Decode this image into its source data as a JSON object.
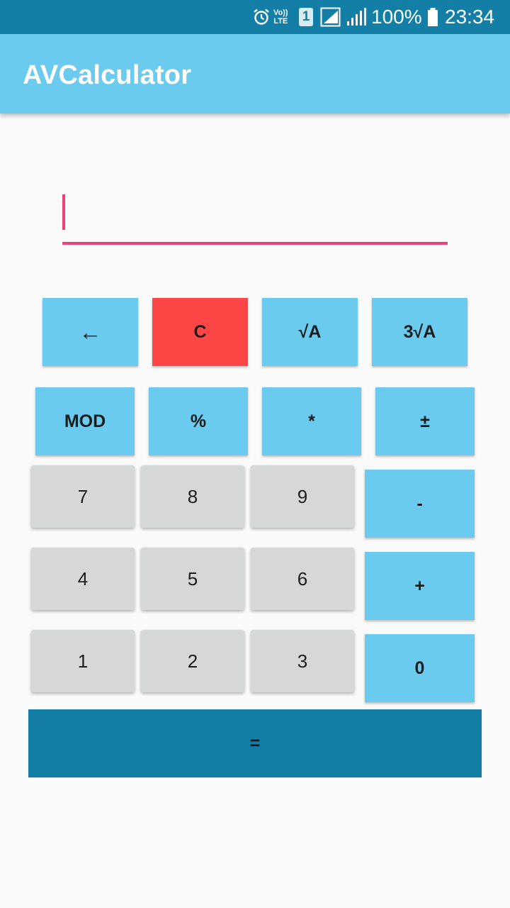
{
  "status_bar": {
    "volte_line1": "Vo))",
    "volte_line2": "LTE",
    "sim_slot": "1",
    "battery_text": "100%",
    "time": "23:34",
    "icons": [
      "alarm-icon",
      "signal-icon",
      "battery-icon"
    ]
  },
  "app": {
    "title": "AVCalculator"
  },
  "display": {
    "value": ""
  },
  "keypad": {
    "backspace": "←",
    "clear": "C",
    "sqrt": "√A",
    "cbrt": "3√A",
    "mod": "MOD",
    "percent": "%",
    "multiply": "*",
    "plus_minus": "±",
    "seven": "7",
    "eight": "8",
    "nine": "9",
    "minus": "-",
    "four": "4",
    "five": "5",
    "six": "6",
    "plus": "+",
    "one": "1",
    "two": "2",
    "three": "3",
    "zero": "0",
    "equals": "="
  },
  "colors": {
    "status_bar": "#137fa6",
    "app_bar": "#6acbee",
    "accent": "#ec407a",
    "operator_button": "#6acbee",
    "clear_button": "#ff4646",
    "digit_button": "#d6d7d7",
    "equals_button": "#137fa6",
    "background": "#fafafa"
  }
}
